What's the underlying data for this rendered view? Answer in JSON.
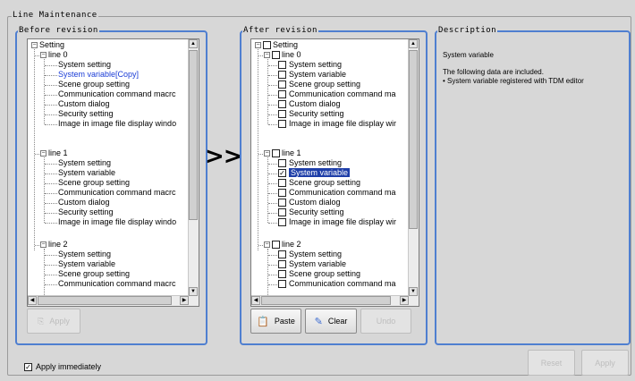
{
  "window": {
    "title": "Line Maintenance"
  },
  "before": {
    "title": "Before revision",
    "root": "Setting",
    "line0": {
      "label": "line 0",
      "items": [
        "System setting",
        "System variable[Copy]",
        "Scene group setting",
        "Communication command macrc",
        "Custom dialog",
        "Security setting",
        "Image in image file display windo"
      ]
    },
    "line1": {
      "label": "line 1",
      "items": [
        "System setting",
        "System variable",
        "Scene group setting",
        "Communication command macrc",
        "Custom dialog",
        "Security setting",
        "Image in image file display windo"
      ]
    },
    "line2": {
      "label": "line 2",
      "items": [
        "System setting",
        "System variable",
        "Scene group setting",
        "Communication command macrc"
      ]
    },
    "apply_label": "Apply"
  },
  "transfer_label": ">>",
  "after": {
    "title": "After revision",
    "root": "Setting",
    "line0": {
      "label": "line 0",
      "items": [
        "System setting",
        "System variable",
        "Scene group setting",
        "Communication command ma",
        "Custom dialog",
        "Security setting",
        "Image in image file display wir"
      ]
    },
    "line1": {
      "label": "line 1",
      "items": [
        "System setting",
        "System variable",
        "Scene group setting",
        "Communication command ma",
        "Custom dialog",
        "Security setting",
        "Image in image file display wir"
      ],
      "checked_index": 1
    },
    "line2": {
      "label": "line 2",
      "items": [
        "System setting",
        "System variable",
        "Scene group setting",
        "Communication command ma"
      ]
    },
    "paste_label": "Paste",
    "clear_label": "Clear",
    "undo_label": "Undo"
  },
  "description": {
    "title": "Description",
    "heading": "System variable",
    "text1": "The following data are included.",
    "text2": "• System variable registered with TDM editor"
  },
  "footer": {
    "apply_immediately_label": "Apply immediately",
    "apply_immediately_checked": true,
    "reset_label": "Reset",
    "apply_label": "Apply"
  },
  "colors": {
    "group_border": "#4f7fd0",
    "selected_text": "#1a3cd6",
    "highlight": "#1e3ea8"
  }
}
